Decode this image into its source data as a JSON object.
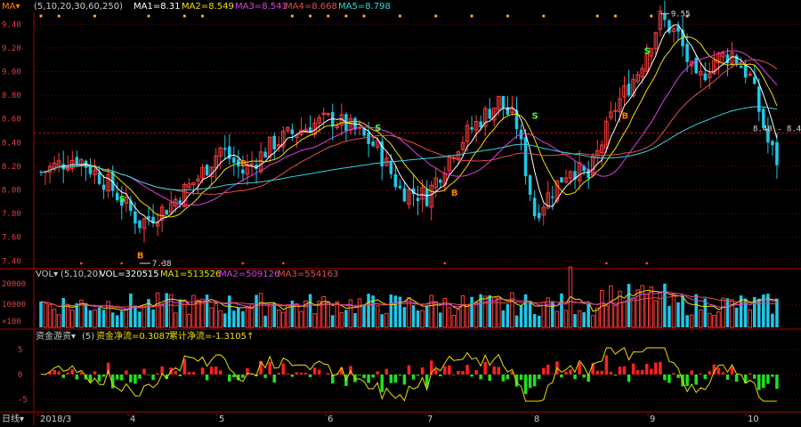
{
  "colors": {
    "up": "#ff3b3b",
    "down": "#1ec8e8",
    "grid": "#7a0000",
    "axis": "#b00000",
    "ma1": "#ffffff",
    "ma2": "#f0e000",
    "ma3": "#e040e0",
    "ma4": "#e05050",
    "ma5": "#30d8e0",
    "cap_pos": "#ff2020",
    "cap_neg": "#20e020",
    "cap_line": "#e8e000",
    "signal_s": "#40ff40",
    "signal_b": "#ff8000",
    "dot": "#ffb000"
  },
  "header": {
    "indicator_name": "MA▾",
    "params": "(5,10,20,30,60,250)",
    "ma1_label": "MA1=8.31",
    "ma2_label": "MA2=8.549",
    "ma3_label": "MA3=8.541",
    "ma4_label": "MA4=8.668",
    "ma5_label": "MA5=8.798",
    "arrows": "↓"
  },
  "volume_header": {
    "name": "VOL▾",
    "params": "(5,10,20)",
    "vol_label": "VOL=320515",
    "ma1_label": "MA1=513526",
    "ma2_label": "MA2=509126",
    "ma3_label": "MA3=554163"
  },
  "capital_header": {
    "name": "资金游资▾",
    "params": "(5)",
    "net_label": "资金净流=0.3087",
    "cum_label": "累计净流=-1.3105↑"
  },
  "footer": {
    "period_button": "日线▾",
    "month_labels": [
      "2018/3",
      "4",
      "5",
      "6",
      "7",
      "8",
      "9",
      "10"
    ]
  },
  "price_axis": {
    "ticks": [
      "9.40",
      "9.20",
      "9.00",
      "8.80",
      "8.60",
      "8.40",
      "8.20",
      "8.00",
      "7.80",
      "7.60",
      "7.40"
    ]
  },
  "volume_axis": {
    "ticks": [
      "20000",
      "10000",
      "×100"
    ]
  },
  "capital_axis": {
    "ticks": [
      "5",
      "0",
      "-5"
    ]
  },
  "annotations": {
    "high_label": "9.55",
    "low_label": "7.38",
    "right_label": "8.48 - 8.49",
    "s_label": "S",
    "b_label": "B"
  },
  "chart_data": {
    "type": "candlestick",
    "ylim": [
      7.35,
      9.5
    ],
    "series_note": "daily OHLC, 2018/3 to 2018/10",
    "ohlc": []
  }
}
